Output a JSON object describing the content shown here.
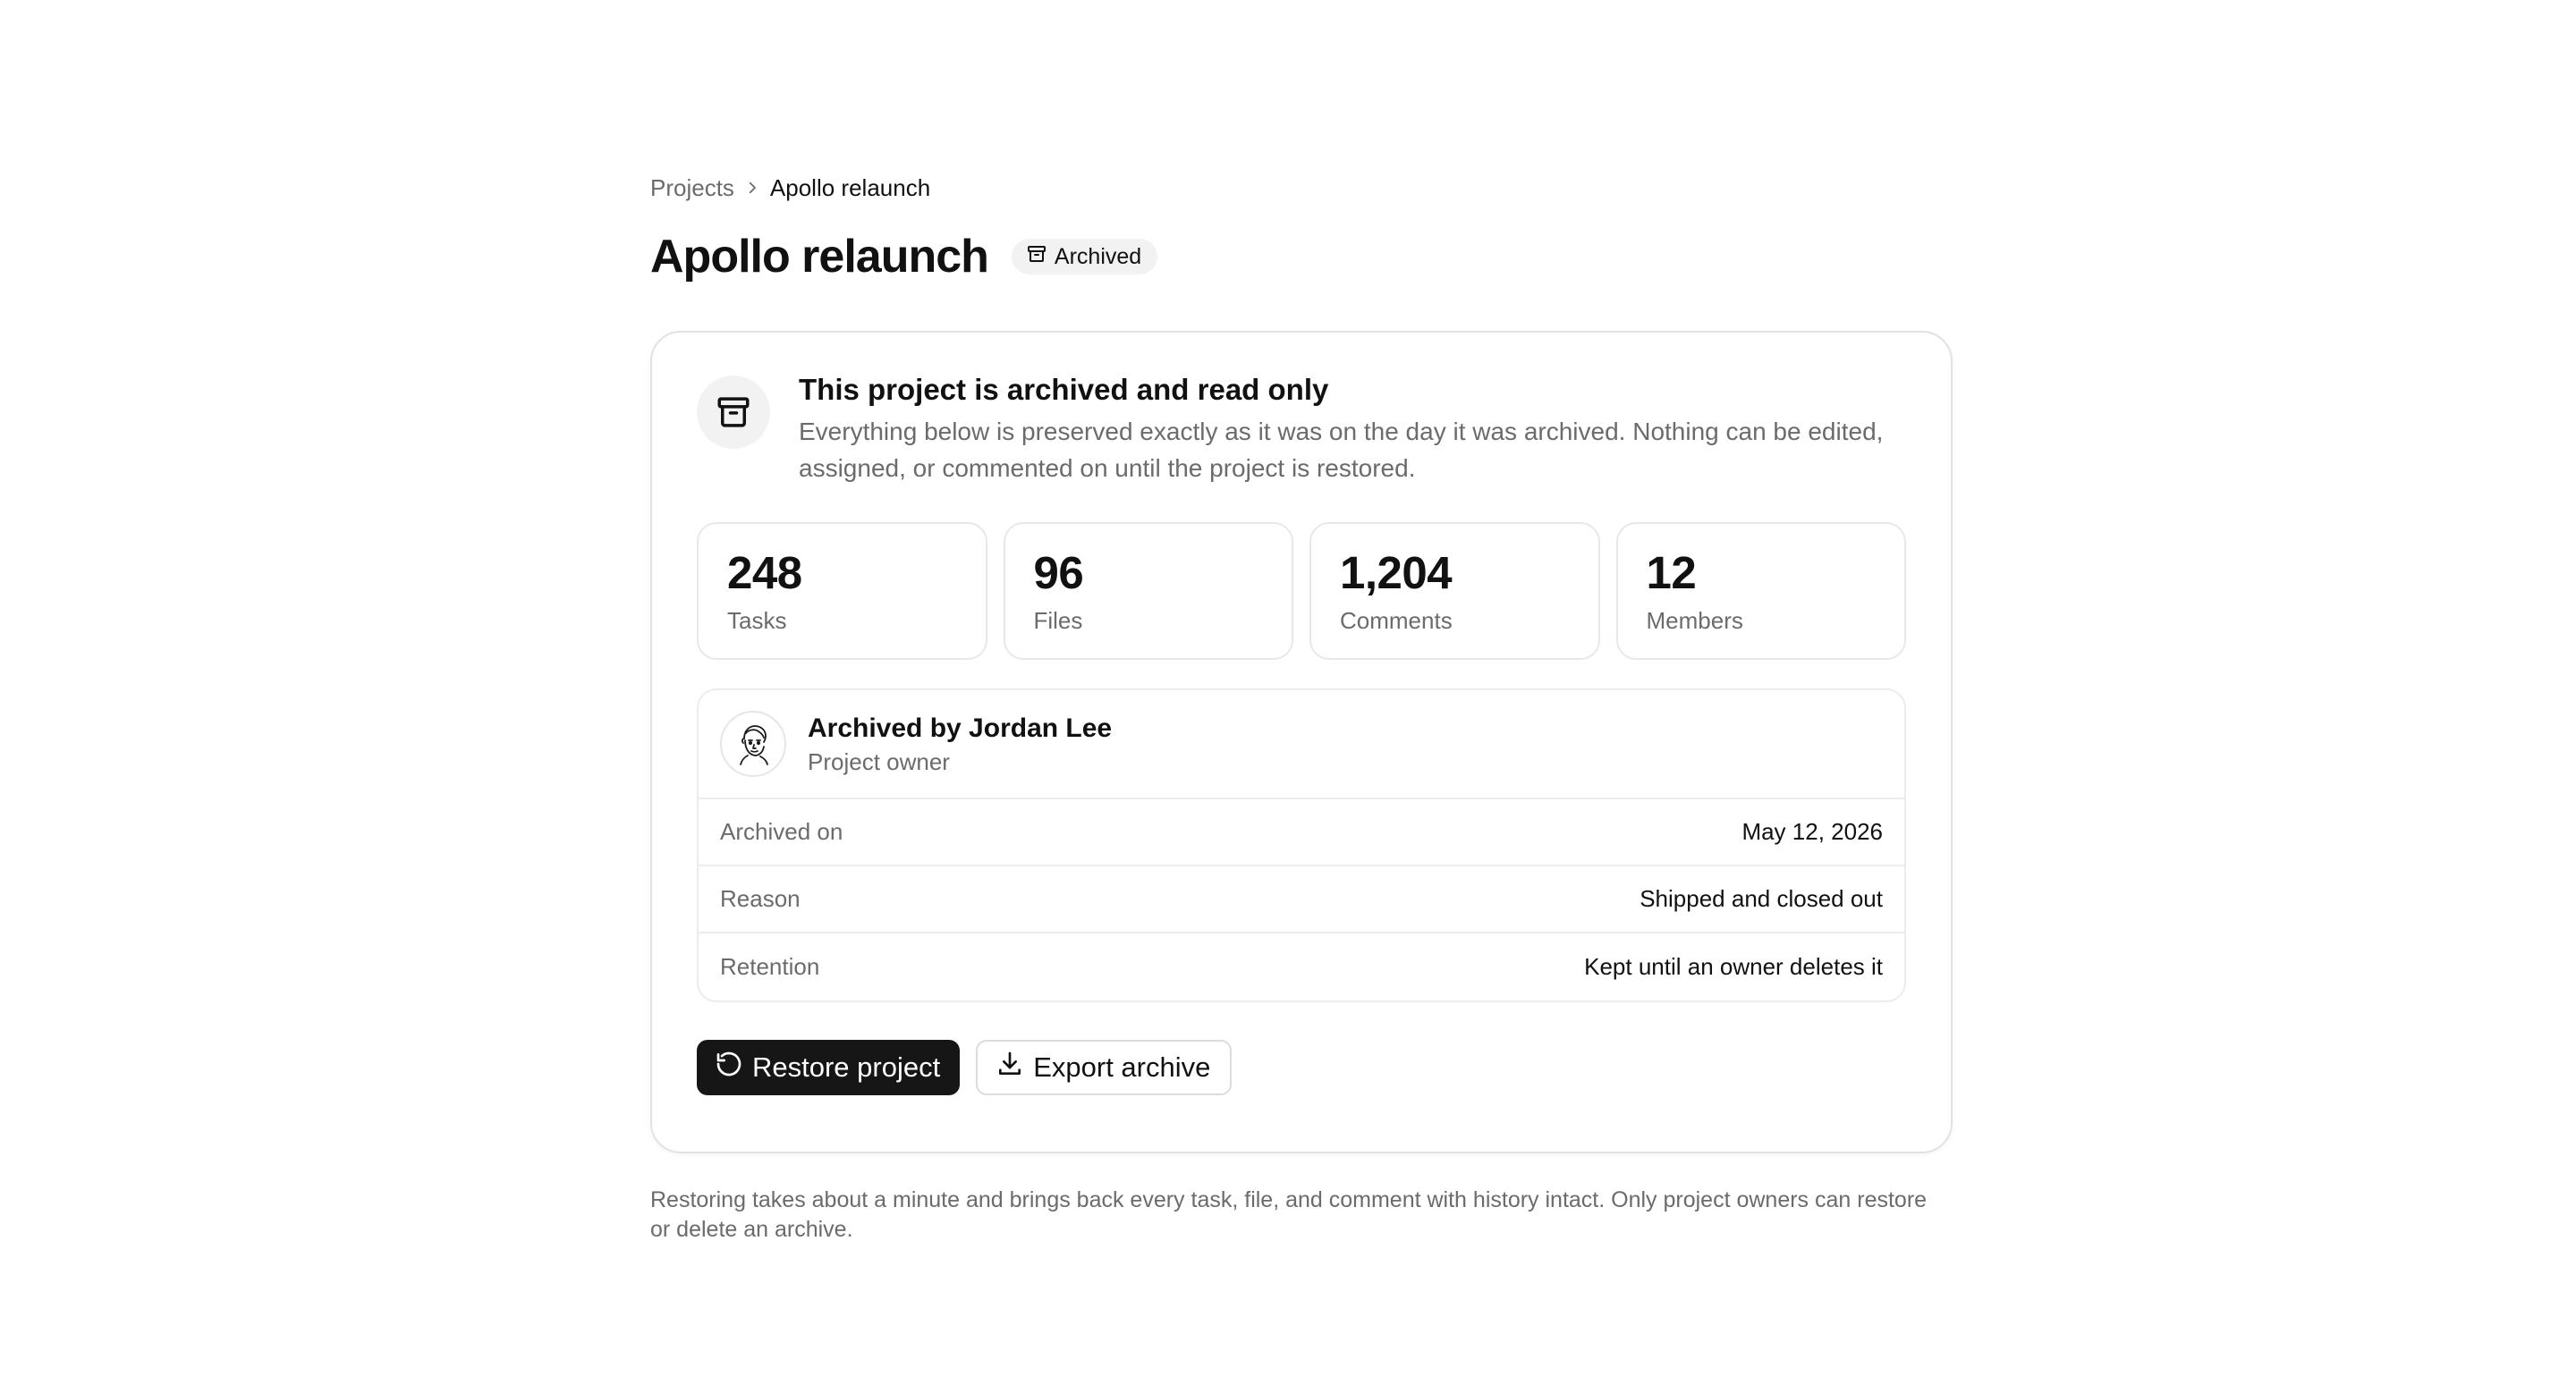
{
  "breadcrumb": {
    "parent": "Projects",
    "current": "Apollo relaunch"
  },
  "header": {
    "title": "Apollo relaunch",
    "badge": "Archived"
  },
  "notice": {
    "title": "This project is archived and read only",
    "body": "Everything below is preserved exactly as it was on the day it was archived. Nothing can be edited, assigned, or commented on until the project is restored."
  },
  "stats": [
    {
      "value": "248",
      "label": "Tasks"
    },
    {
      "value": "96",
      "label": "Files"
    },
    {
      "value": "1,204",
      "label": "Comments"
    },
    {
      "value": "12",
      "label": "Members"
    }
  ],
  "archived_by": {
    "name": "Archived by Jordan Lee",
    "role": "Project owner"
  },
  "details": [
    {
      "key": "Archived on",
      "value": "May 12, 2026"
    },
    {
      "key": "Reason",
      "value": "Shipped and closed out"
    },
    {
      "key": "Retention",
      "value": "Kept until an owner deletes it"
    }
  ],
  "actions": {
    "restore": "Restore project",
    "export": "Export archive"
  },
  "footnote": "Restoring takes about a minute and brings back every task, file, and comment with history intact. Only project owners can restore or delete an archive.",
  "icons": {
    "breadcrumb_separator": "chevron-right-icon",
    "badge": "archive-icon",
    "notice": "archive-box-icon",
    "restore": "rotate-ccw-icon",
    "export": "download-icon"
  },
  "colors": {
    "primary_button": "#161616",
    "muted_text": "#6b6b6b",
    "border": "#e2e2e2"
  }
}
